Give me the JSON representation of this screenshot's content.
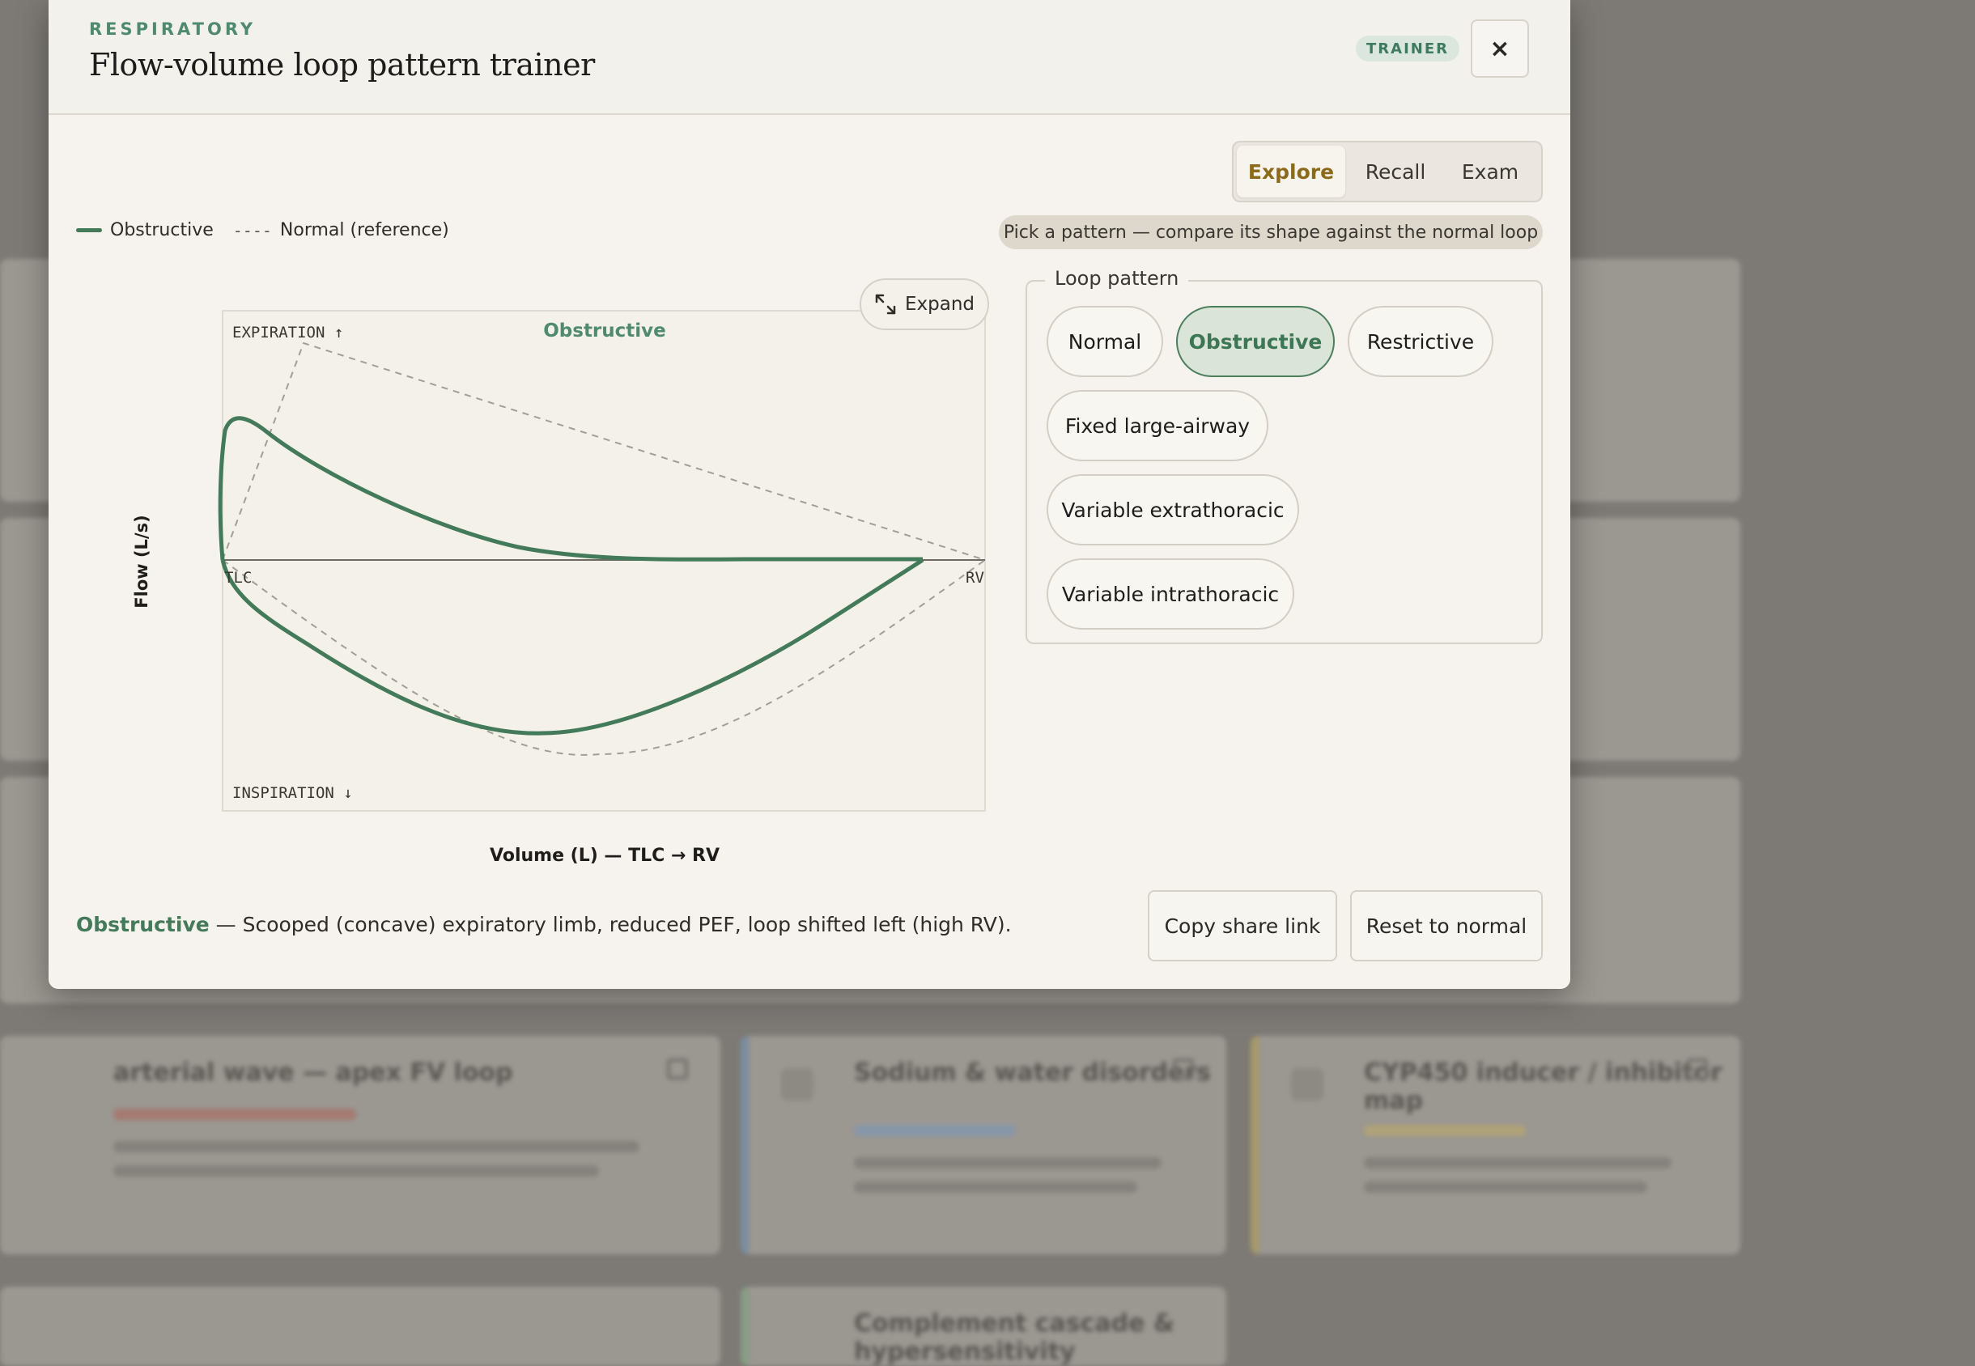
{
  "header": {
    "eyebrow": "RESPIRATORY",
    "title": "Flow-volume loop pattern trainer",
    "badge": "TRAINER",
    "close_icon": "×"
  },
  "mode_tabs": [
    {
      "label": "Explore",
      "active": true
    },
    {
      "label": "Recall",
      "active": false
    },
    {
      "label": "Exam",
      "active": false
    }
  ],
  "legend": {
    "series_label": "Obstructive",
    "dash_glyph": "----",
    "reference_label": "Normal (reference)"
  },
  "hint": "Pick a pattern — compare its shape against the normal loop",
  "expand_label": "Expand",
  "loop_pattern": {
    "legend": "Loop pattern",
    "options": [
      {
        "label": "Normal",
        "active": false
      },
      {
        "label": "Obstructive",
        "active": true
      },
      {
        "label": "Restrictive",
        "active": false
      },
      {
        "label": "Fixed large-airway",
        "active": false
      },
      {
        "label": "Variable extrathoracic",
        "active": false
      },
      {
        "label": "Variable intrathoracic",
        "active": false
      }
    ]
  },
  "chart_data": {
    "type": "line",
    "title": "Obstructive",
    "xlabel": "Volume (L) — TLC → RV",
    "ylabel": "Flow (L/s)",
    "annotations": {
      "expiration": "EXPIRATION ↑",
      "inspiration": "INSPIRATION ↓",
      "tlc": "TLC",
      "rv": "RV"
    },
    "series": [
      {
        "name": "Obstructive",
        "style": "solid",
        "color": "#437a5a"
      },
      {
        "name": "Normal (reference)",
        "style": "dashed",
        "color": "#9a958d"
      }
    ]
  },
  "description": {
    "highlight": "Obstructive",
    "text": " — Scooped (concave) expiratory limb, reduced PEF, loop shifted left (high RV)."
  },
  "footer_buttons": {
    "copy": "Copy share link",
    "reset": "Reset to normal"
  },
  "background_cards": [
    {
      "title": "arterial wave — apex FV loop"
    },
    {
      "title": "Sodium & water disorders"
    },
    {
      "title": "CYP450 inducer / inhibitor map"
    },
    {
      "title": "Complement cascade & hypersensitivity"
    }
  ],
  "colors": {
    "accent_green": "#437a5a",
    "accent_gold": "#8c6a1c",
    "eyebrow_green": "#4f8a6f"
  }
}
